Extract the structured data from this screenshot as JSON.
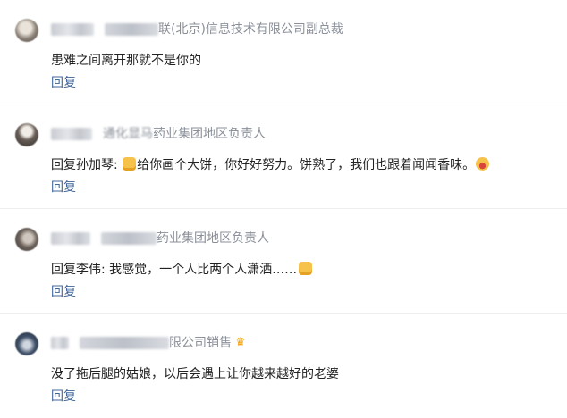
{
  "comments": [
    {
      "title_visible": "联(北京)信息技术有限公司副总裁",
      "text": "患难之间离开那就不是你的",
      "reply_label": "回复"
    },
    {
      "title_visible": "药业集团地区负责人",
      "title_blurred_partial": "通化显马",
      "text_before": "回复孙加琴: ",
      "text_middle": "给你画个大饼，你好好努力。饼熟了，我们也跟着闻闻香味。",
      "reply_label": "回复"
    },
    {
      "title_visible": "药业集团地区负责人",
      "text": "回复李伟: 我感觉，一个人比两个人潇洒……",
      "reply_label": "回复"
    },
    {
      "title_visible": "限公司销售",
      "text": "没了拖后腿的姑娘，以后会遇上让你越来越好的老婆",
      "reply_label": "回复"
    }
  ],
  "icons": {
    "crown": "crown-icon",
    "emoji_pie": "pie-emoji-icon",
    "emoji_grin": "grin-emoji-icon"
  },
  "colors": {
    "reply_link": "#406599",
    "title_gray": "#8a8f99",
    "crown": "#f2a71b"
  }
}
